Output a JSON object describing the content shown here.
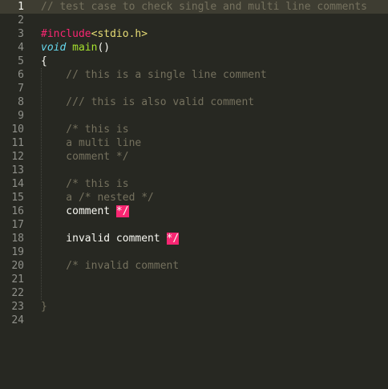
{
  "editor": {
    "theme_colors": {
      "background": "#272822",
      "active_line": "#3e3d32",
      "comment": "#75715e",
      "invalid_bg": "#f92672",
      "keyword_pink": "#f92672",
      "string_yellow": "#e6db74",
      "storage_cyan": "#66d9ef",
      "function_green": "#a6e22e",
      "text": "#f8f8f2"
    },
    "lines": [
      {
        "n": "1",
        "segments": [
          {
            "t": "// test case to check single and multi line comments",
            "c": "cmt"
          }
        ]
      },
      {
        "n": "2",
        "segments": []
      },
      {
        "n": "3",
        "segments": [
          {
            "t": "#include",
            "c": "kw-pink"
          },
          {
            "t": "<stdio.h>",
            "c": "str-yel"
          }
        ]
      },
      {
        "n": "4",
        "segments": [
          {
            "t": "void",
            "c": "kw-cyan"
          },
          {
            "t": " ",
            "c": "plain"
          },
          {
            "t": "main",
            "c": "fn-green"
          },
          {
            "t": "()",
            "c": "plain"
          }
        ]
      },
      {
        "n": "5",
        "segments": [
          {
            "t": "{",
            "c": "plain"
          }
        ]
      },
      {
        "n": "6",
        "segments": [
          {
            "t": "    // this is a single line comment",
            "c": "cmt"
          }
        ]
      },
      {
        "n": "7",
        "segments": []
      },
      {
        "n": "8",
        "segments": [
          {
            "t": "    /// this is also valid comment",
            "c": "cmt"
          }
        ]
      },
      {
        "n": "9",
        "segments": []
      },
      {
        "n": "10",
        "segments": [
          {
            "t": "    /* this is",
            "c": "cmt"
          }
        ]
      },
      {
        "n": "11",
        "segments": [
          {
            "t": "    a multi line",
            "c": "cmt"
          }
        ]
      },
      {
        "n": "12",
        "segments": [
          {
            "t": "    comment */",
            "c": "cmt"
          }
        ]
      },
      {
        "n": "13",
        "segments": []
      },
      {
        "n": "14",
        "segments": [
          {
            "t": "    /* this is",
            "c": "cmt"
          }
        ]
      },
      {
        "n": "15",
        "segments": [
          {
            "t": "    a /* nested */",
            "c": "cmt"
          }
        ]
      },
      {
        "n": "16",
        "segments": [
          {
            "t": "    comment ",
            "c": "plain"
          },
          {
            "t": "*/",
            "c": "invalid"
          }
        ]
      },
      {
        "n": "17",
        "segments": []
      },
      {
        "n": "18",
        "segments": [
          {
            "t": "    invalid comment ",
            "c": "plain"
          },
          {
            "t": "*/",
            "c": "invalid"
          }
        ]
      },
      {
        "n": "19",
        "segments": []
      },
      {
        "n": "20",
        "segments": [
          {
            "t": "    /* invalid comment",
            "c": "cmt"
          }
        ]
      },
      {
        "n": "21",
        "segments": []
      },
      {
        "n": "22",
        "segments": []
      },
      {
        "n": "23",
        "segments": [
          {
            "t": "}",
            "c": "cmt"
          }
        ]
      },
      {
        "n": "24",
        "segments": []
      }
    ],
    "active_line": "1"
  }
}
